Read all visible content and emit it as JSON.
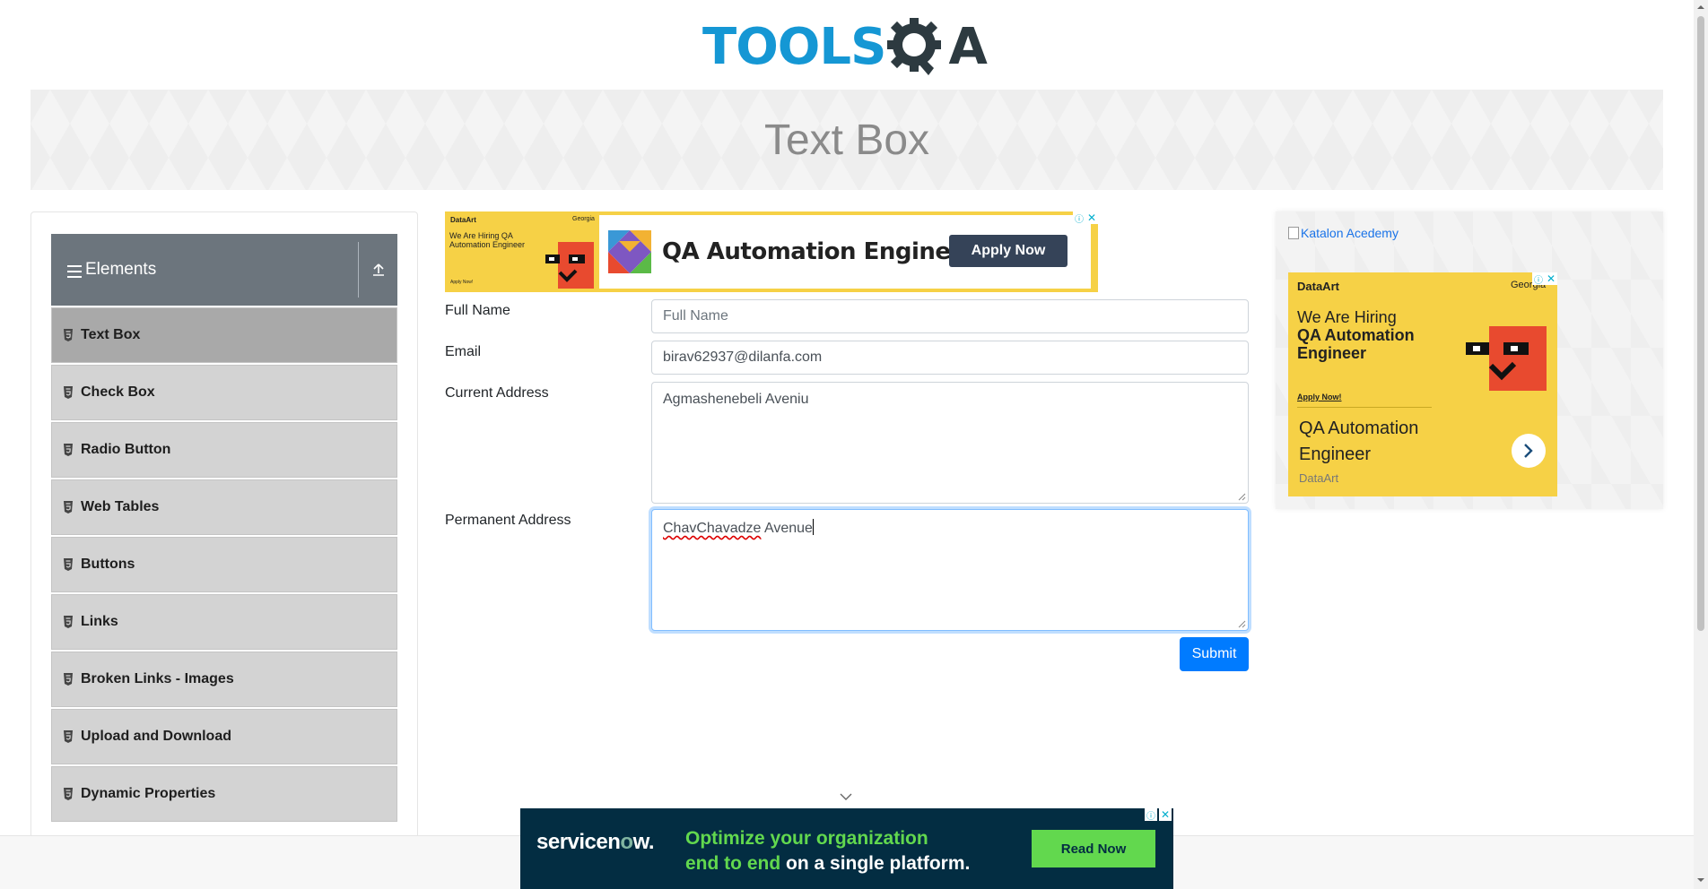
{
  "logo": {
    "left_text": "TOOLS",
    "right_text": "A"
  },
  "banner": {
    "title": "Text Box"
  },
  "sidebar": {
    "group_title": "Elements",
    "items": [
      {
        "label": "Text Box",
        "active": true
      },
      {
        "label": "Check Box"
      },
      {
        "label": "Radio Button"
      },
      {
        "label": "Web Tables"
      },
      {
        "label": "Buttons"
      },
      {
        "label": "Links"
      },
      {
        "label": "Broken Links - Images"
      },
      {
        "label": "Upload and Download"
      },
      {
        "label": "Dynamic Properties"
      }
    ]
  },
  "top_ad": {
    "brand": "DataArt",
    "location": "Georgia",
    "hiring_text": "We Are Hiring QA Automation Engineer",
    "apply_small": "Apply Now!",
    "headline": "QA Automation Engineer",
    "button": "Apply Now"
  },
  "form": {
    "full_name": {
      "label": "Full Name",
      "placeholder": "Full Name",
      "value": ""
    },
    "email": {
      "label": "Email",
      "value": "birav62937@dilanfa.com"
    },
    "current_address": {
      "label": "Current Address",
      "value": "Agmashenebeli Aveniu"
    },
    "permanent_address": {
      "label": "Permanent Address",
      "value_part1": "ChavChavadze",
      "value_part2": " Avenue"
    },
    "submit": "Submit"
  },
  "side_ad": {
    "image_alt": "Katalon Acedemy",
    "brand": "DataArt",
    "location": "Georgia",
    "hiring_line1": "We Are Hiring",
    "hiring_line2": "QA Automation Engineer",
    "apply": "Apply Now!",
    "headline": "QA Automation Engineer",
    "sub": "DataArt"
  },
  "bottom_ad": {
    "logo_pre": "servicen",
    "logo_o": "o",
    "logo_post": "w.",
    "line1": "Optimize your organization",
    "line2_green": "end to end",
    "line2_white": " on a single platform.",
    "button": "Read Now"
  },
  "colors": {
    "primary": "#007bff",
    "sidebar_header": "#6c757d",
    "menu_item": "#d3d3d3",
    "menu_active": "#a9a9a9",
    "logo_blue": "#1597d4",
    "ad_yellow": "#f6d146",
    "servicenow_bg": "#032d42",
    "servicenow_green": "#62d84e"
  }
}
